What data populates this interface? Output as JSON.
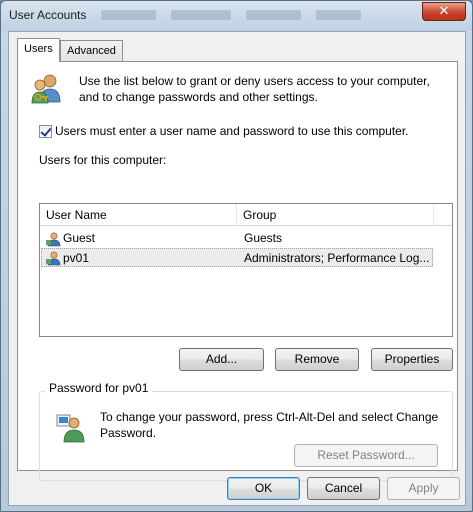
{
  "window": {
    "title": "User Accounts",
    "close_glyph": "✕"
  },
  "tabs": [
    {
      "label": "Users",
      "active": true
    },
    {
      "label": "Advanced",
      "active": false
    }
  ],
  "intro": {
    "icon": "users-keys-icon",
    "text_line1": "Use the list below to grant or deny users access to your computer,",
    "text_line2": "and to change passwords and other settings."
  },
  "require_login": {
    "checked": true,
    "label": "Users must enter a user name and password to use this computer."
  },
  "users_list": {
    "label": "Users for this computer:",
    "columns": [
      "User Name",
      "Group"
    ],
    "rows": [
      {
        "name": "Guest",
        "group": "Guests",
        "icon": "user-icon",
        "selected": false
      },
      {
        "name": "pv01",
        "group": "Administrators; Performance Log...",
        "icon": "user-icon",
        "selected": true
      }
    ]
  },
  "list_buttons": {
    "add": "Add...",
    "remove": "Remove",
    "properties": "Properties"
  },
  "password_group": {
    "title": "Password for pv01",
    "icon": "user-password-icon",
    "text_line1": "To change your password, press Ctrl-Alt-Del and select Change",
    "text_line2": "Password.",
    "reset_button": "Reset Password..."
  },
  "dialog_buttons": {
    "ok": "OK",
    "cancel": "Cancel",
    "apply": "Apply"
  }
}
